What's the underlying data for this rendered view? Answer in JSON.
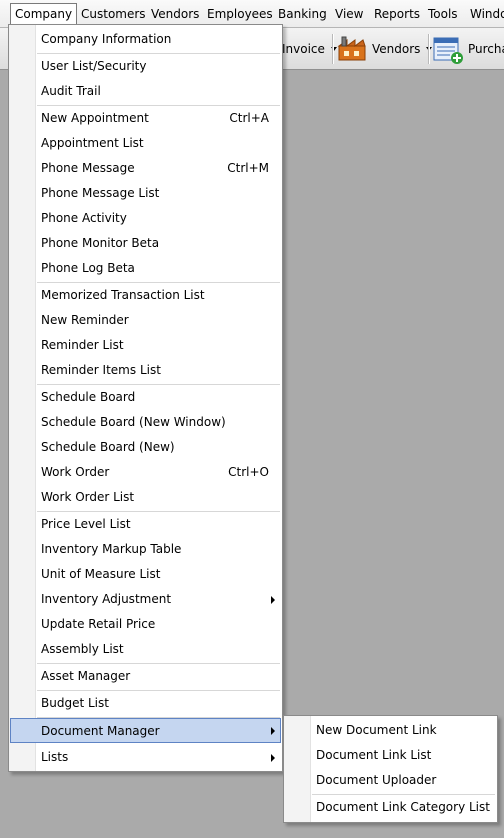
{
  "menubar": {
    "company": "Company",
    "customers": "Customers",
    "vendors": "Vendors",
    "employees": "Employees",
    "banking": "Banking",
    "view": "View",
    "reports": "Reports",
    "tools": "Tools",
    "window": "Windo"
  },
  "toolbar": {
    "invoice": "Invoice",
    "vendors": "Vendors",
    "purchase": "Purchas"
  },
  "company_menu": {
    "company_information": "Company Information",
    "user_list_security": "User List/Security",
    "audit_trail": "Audit Trail",
    "new_appointment": "New Appointment",
    "new_appointment_shortcut": "Ctrl+A",
    "appointment_list": "Appointment List",
    "phone_message": "Phone Message",
    "phone_message_shortcut": "Ctrl+M",
    "phone_message_list": "Phone Message List",
    "phone_activity": "Phone Activity",
    "phone_monitor_beta": "Phone Monitor Beta",
    "phone_log_beta": "Phone Log Beta",
    "memorized_transaction_list": "Memorized Transaction List",
    "new_reminder": "New Reminder",
    "reminder_list": "Reminder List",
    "reminder_items_list": "Reminder Items List",
    "schedule_board": "Schedule Board",
    "schedule_board_new_window": "Schedule Board (New Window)",
    "schedule_board_new": "Schedule Board (New)",
    "work_order": "Work Order",
    "work_order_shortcut": "Ctrl+O",
    "work_order_list": "Work Order List",
    "price_level_list": "Price Level List",
    "inventory_markup_table": "Inventory Markup Table",
    "unit_of_measure_list": "Unit of Measure List",
    "inventory_adjustment": "Inventory Adjustment",
    "update_retail_price": "Update Retail Price",
    "assembly_list": "Assembly List",
    "asset_manager": "Asset Manager",
    "budget_list": "Budget List",
    "document_manager": "Document Manager",
    "lists": "Lists"
  },
  "document_submenu": {
    "new_document_link": "New Document Link",
    "document_link_list": "Document Link List",
    "document_uploader": "Document Uploader",
    "document_link_category_list": "Document Link Category List"
  },
  "colors": {
    "highlight_bg": "#c5d6f0",
    "highlight_border": "#5e83c4",
    "desktop_bg": "#aaaaaa"
  }
}
